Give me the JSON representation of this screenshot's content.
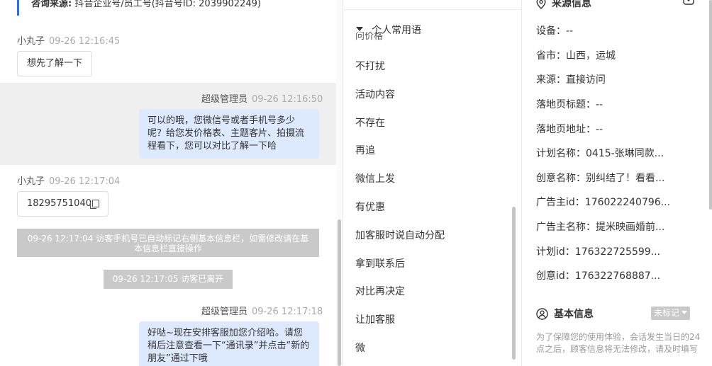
{
  "chat": {
    "top_card": {
      "label": "咨询来源:",
      "value": "抖音企业号/员工号(抖音号ID: 2039902249)"
    },
    "messages": [
      {
        "name": "小丸子",
        "time": "09-26 12:16:45",
        "text": "想先了解一下"
      },
      {
        "name": "超级管理员",
        "time": "09-26 12:16:50",
        "text": "可以的哦，您微信号或者手机号多少呢？给您发价格表、主题客片、拍摄流程看下，您可以对比了解一下哈"
      },
      {
        "name": "小丸子",
        "time": "09-26 12:17:04",
        "text": "18295751040"
      },
      {
        "name": "超级管理员",
        "time": "09-26 12:17:18",
        "text": "好哒~现在安排客服加您介绍哈。请您稍后注意查看一下“通讯录”并点击“新的朋友”通过下哦"
      }
    ],
    "notices": {
      "auto_mark": "09-26 12:17:04 访客手机号已自动标记右侧基本信息栏，如需修改请在基本信息栏直接操作",
      "left": "09-26 12:17:05 访客已离开"
    }
  },
  "phrases": {
    "group_title": "个人常用语",
    "clipped_item": "问价格",
    "items": [
      "不打扰",
      "活动内容",
      "不存在",
      "再追",
      "微信上发",
      "有优惠",
      "加客服时说自动分配",
      "拿到联系后",
      "对比再决定",
      "让加客服",
      "微"
    ]
  },
  "info": {
    "source_title": "来源信息",
    "fields": [
      {
        "label": "设备：",
        "value": "--"
      },
      {
        "label": "省市：",
        "value": "山西，运城"
      },
      {
        "label": "来源：",
        "value": "直接访问"
      },
      {
        "label": "落地页标题：",
        "value": "--"
      },
      {
        "label": "落地页地址：",
        "value": "--"
      },
      {
        "label": "计划名称：",
        "value": "0415-张琳同款..."
      },
      {
        "label": "创意名称：",
        "value": "别纠结了！看看..."
      },
      {
        "label": "广告主id：",
        "value": "176022240796..."
      },
      {
        "label": "广告主名称：",
        "value": "提米映画婚前..."
      },
      {
        "label": "计划id：",
        "value": "176322725599..."
      },
      {
        "label": "创意id：",
        "value": "176322768887..."
      }
    ],
    "basic_title": "基本信息",
    "tag_label": "未标记",
    "hint": "为了保障您的使用体验，会话发生当日的24点之后，顾客信息将无法修改，请及时填写"
  },
  "colors": {
    "accent": "#1f6fff",
    "admin_bubble": "#dde9ff",
    "notice_bg": "#c9c9c9"
  }
}
